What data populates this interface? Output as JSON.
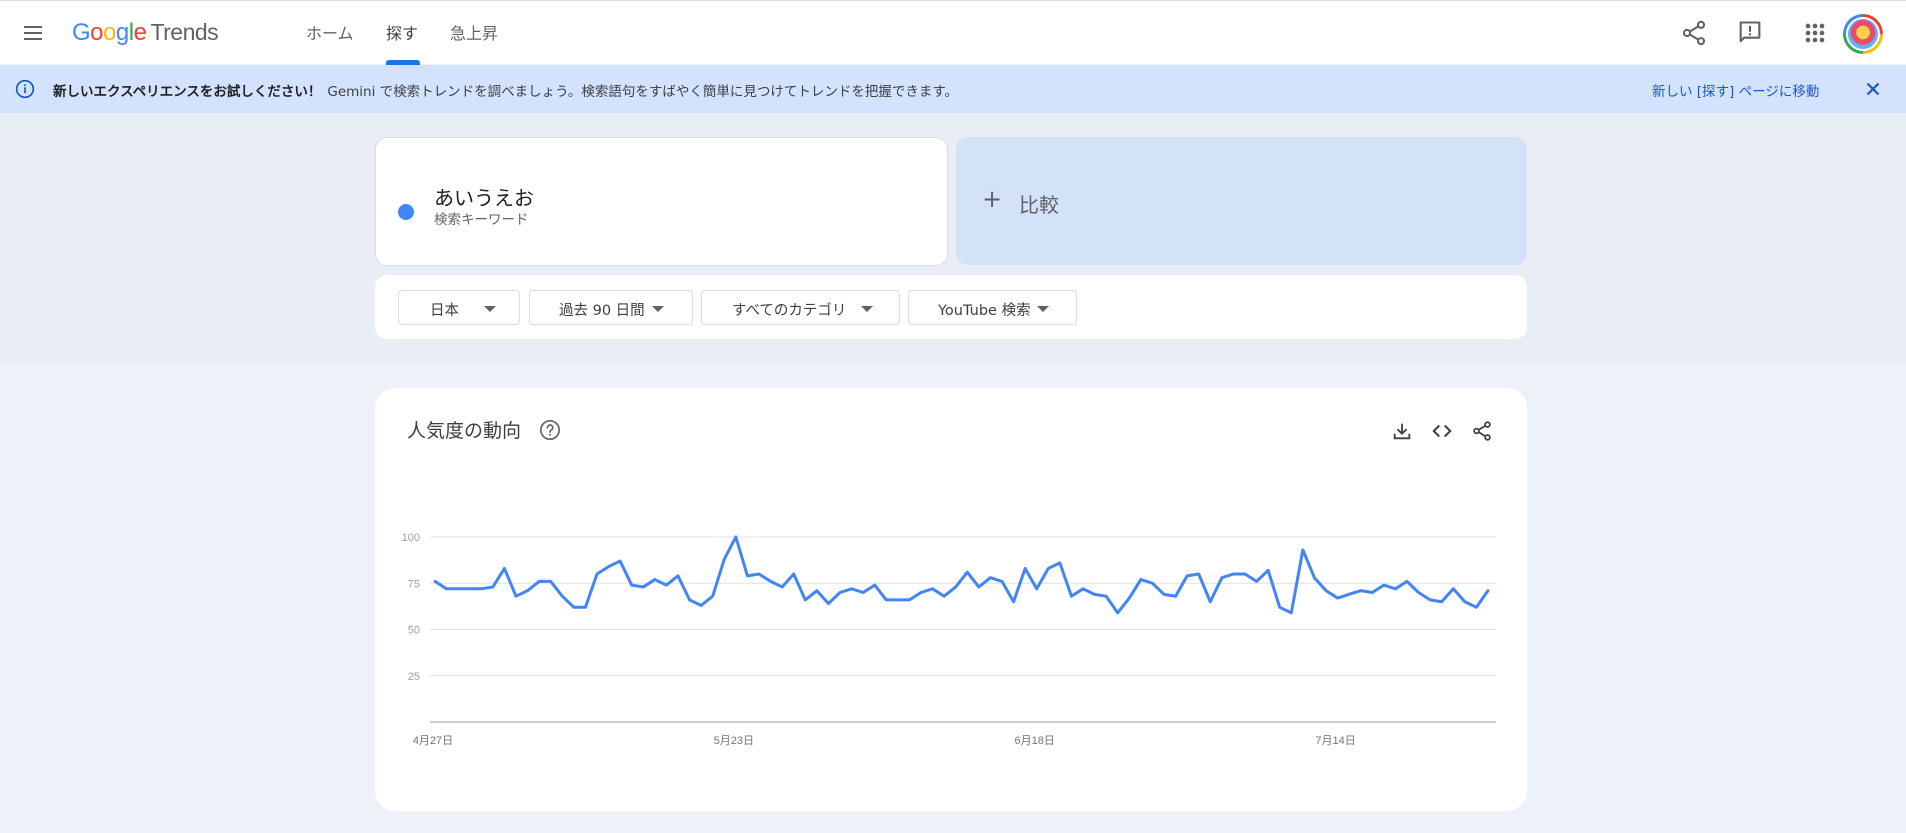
{
  "header": {
    "logo_google": "Google",
    "logo_product": "Trends",
    "tabs": [
      {
        "label": "ホーム"
      },
      {
        "label": "探す"
      },
      {
        "label": "急上昇"
      }
    ],
    "active_tab": "探す",
    "icons": [
      "menu-icon",
      "share-icon",
      "feedback-icon",
      "apps-icon",
      "avatar"
    ]
  },
  "banner": {
    "headline": "新しいエクスペリエンスをお試しください！",
    "message": "Gemini で検索トレンドを調べましょう。検索語句をすばやく簡単に見つけてトレンドを把握できます。",
    "link": "新しい [探す] ページに移動"
  },
  "term": {
    "name": "あいうえお",
    "subtitle": "検索キーワード",
    "color": "#4285f4"
  },
  "compare": {
    "label": "比較"
  },
  "filters": [
    {
      "label": "日本"
    },
    {
      "label": "過去 90 日間"
    },
    {
      "label": "すべてのカテゴリ"
    },
    {
      "label": "YouTube 検索"
    }
  ],
  "chart_card": {
    "title": "人気度の動向",
    "icons": [
      "help-icon",
      "download-icon",
      "embed-icon",
      "share-icon"
    ]
  },
  "chart_data": {
    "type": "line",
    "title": "人気度の動向",
    "ylim": [
      0,
      100
    ],
    "yticks": [
      25,
      50,
      75,
      100
    ],
    "x_tick_labels": [
      "4月27日",
      "5月23日",
      "6月18日",
      "7月14日"
    ],
    "grid": true,
    "series": [
      {
        "color": "#4285f4",
        "start_date": "4月27日",
        "values": [
          76,
          72,
          72,
          72,
          72,
          73,
          83,
          68,
          71,
          76,
          76,
          68,
          62,
          62,
          80,
          84,
          87,
          74,
          73,
          77,
          74,
          79,
          66,
          63,
          68,
          88,
          100,
          79,
          80,
          76,
          73,
          80,
          66,
          71,
          64,
          70,
          72,
          70,
          74,
          66,
          66,
          66,
          70,
          72,
          68,
          73,
          81,
          73,
          78,
          76,
          65,
          83,
          72,
          83,
          86,
          68,
          72,
          69,
          68,
          59,
          67,
          77,
          75,
          69,
          68,
          79,
          80,
          65,
          78,
          80,
          80,
          76,
          82,
          62,
          59,
          93,
          78,
          71,
          67,
          69,
          71,
          70,
          74,
          72,
          76,
          70,
          66,
          65,
          72,
          65,
          62,
          71
        ]
      }
    ]
  }
}
